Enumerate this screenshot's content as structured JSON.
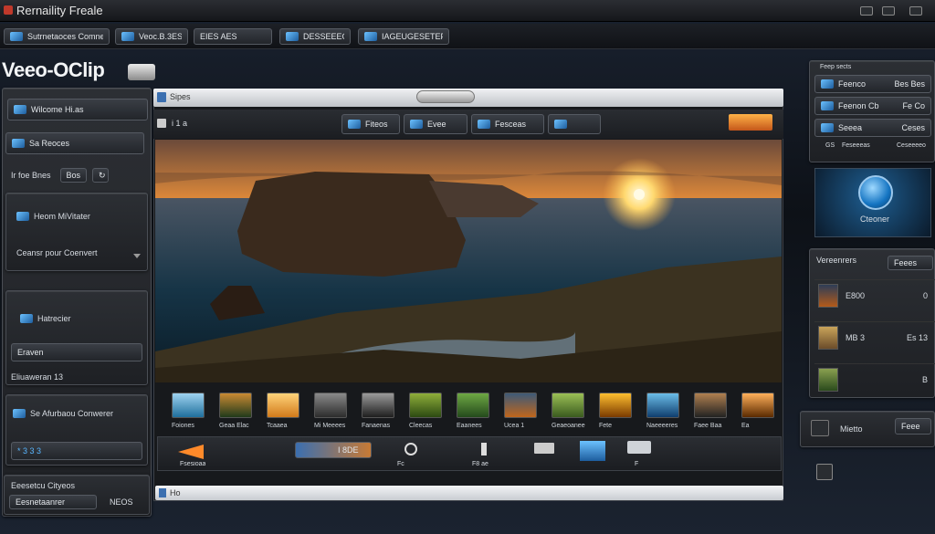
{
  "app": {
    "title": "Rernaility Freale",
    "logo": "Veeo-OClip"
  },
  "menubar": {
    "items": [
      "Sutrnetaoces Comnes",
      "Veoc.B.3ES",
      "EIES AES",
      "DESSEEEG",
      "IAGEUGESETEF"
    ]
  },
  "left_panel": {
    "welcome_label": "Wilcome Hi.as",
    "section_label": "Sa Reoces",
    "file_stat_label": "Ir foe Bnes",
    "file_stat_value": "Bos",
    "group1_title": "Heom MiVitater",
    "group1_sub": "Ceansr pour Coenvert",
    "group2_title": "Hatrecier",
    "group2_field": "Eraven",
    "group2_caption": "Eliuaweran 13",
    "group3_title": "Se Afurbaou Conwerer",
    "group3_value": "* 3 3 3",
    "footer_title": "Eeesetcu Cityeos",
    "footer_left": "Eesnetaanrer",
    "footer_right": "NEOS"
  },
  "viewer": {
    "tab_label": "Sipes",
    "count": "i 1 a",
    "tabs": [
      "Fiteos",
      "Evee",
      "Fesceas",
      ""
    ],
    "status_text": "Ho"
  },
  "thumbnails": [
    {
      "label": "Foiones",
      "color_a": "#1f6f9c",
      "color_b": "#9fd3f0"
    },
    {
      "label": "Geaa Elac",
      "color_a": "#203a1b",
      "color_b": "#c98a33"
    },
    {
      "label": "Tcaaea",
      "color_a": "#d17a1a",
      "color_b": "#ffd37a"
    },
    {
      "label": "Mi Meeees",
      "color_a": "#2c2c2c",
      "color_b": "#8a8a8a"
    },
    {
      "label": "Fanaenas",
      "color_a": "#1e1e1e",
      "color_b": "#9b9b9b"
    },
    {
      "label": "Cleecas",
      "color_a": "#2c4a12",
      "color_b": "#8fae3a"
    },
    {
      "label": "Eaanees",
      "color_a": "#244a1c",
      "color_b": "#6ea844"
    },
    {
      "label": "Ucea 1",
      "color_a": "#c0661c",
      "color_b": "#3d5a78"
    },
    {
      "label": "Geaeoanee",
      "color_a": "#3a5b1f",
      "color_b": "#9bbf55"
    },
    {
      "label": "Fete",
      "color_a": "#7a3a00",
      "color_b": "#ffbf2f"
    },
    {
      "label": "Naeeeeres",
      "color_a": "#0f3e6e",
      "color_b": "#6bbde8"
    },
    {
      "label": "Faee Baa",
      "color_a": "#222",
      "color_b": "#b08050"
    },
    {
      "label": "Ea",
      "color_a": "#5a2a00",
      "color_b": "#ffb05a"
    }
  ],
  "tools": [
    {
      "label": "Fsesioaa"
    },
    {
      "label": "I 8DE"
    },
    {
      "label": "Fc"
    },
    {
      "label": "F8 ae"
    },
    {
      "label": ""
    },
    {
      "label": ""
    },
    {
      "label": "F"
    }
  ],
  "right_panel": {
    "header": "Feep sects",
    "rows": [
      {
        "label": "Feenco",
        "value": "Bes Bes"
      },
      {
        "label": "Feenon Cb",
        "value": "Fe Co"
      },
      {
        "label": "Seeea",
        "value": "Ceses"
      }
    ],
    "footer_left": "GS",
    "footer_mid": "Feseeeas",
    "footer_right": "Ceseeeeo",
    "preview_label": "Cteoner",
    "versions_label": "Vereenrers",
    "versions_button": "Feees",
    "version_items": [
      {
        "label": "E800",
        "value": "0"
      },
      {
        "label": "MB 3",
        "value": "Es 13"
      },
      {
        "label": "",
        "value": "B"
      }
    ],
    "bottom_label": "Mietto",
    "bottom_button": "Feee"
  },
  "colors": {
    "accent": "#3b9ae1",
    "sunset": "#ff9a3d",
    "sea": "#0f2f46",
    "cliff": "#3a2a1d"
  }
}
